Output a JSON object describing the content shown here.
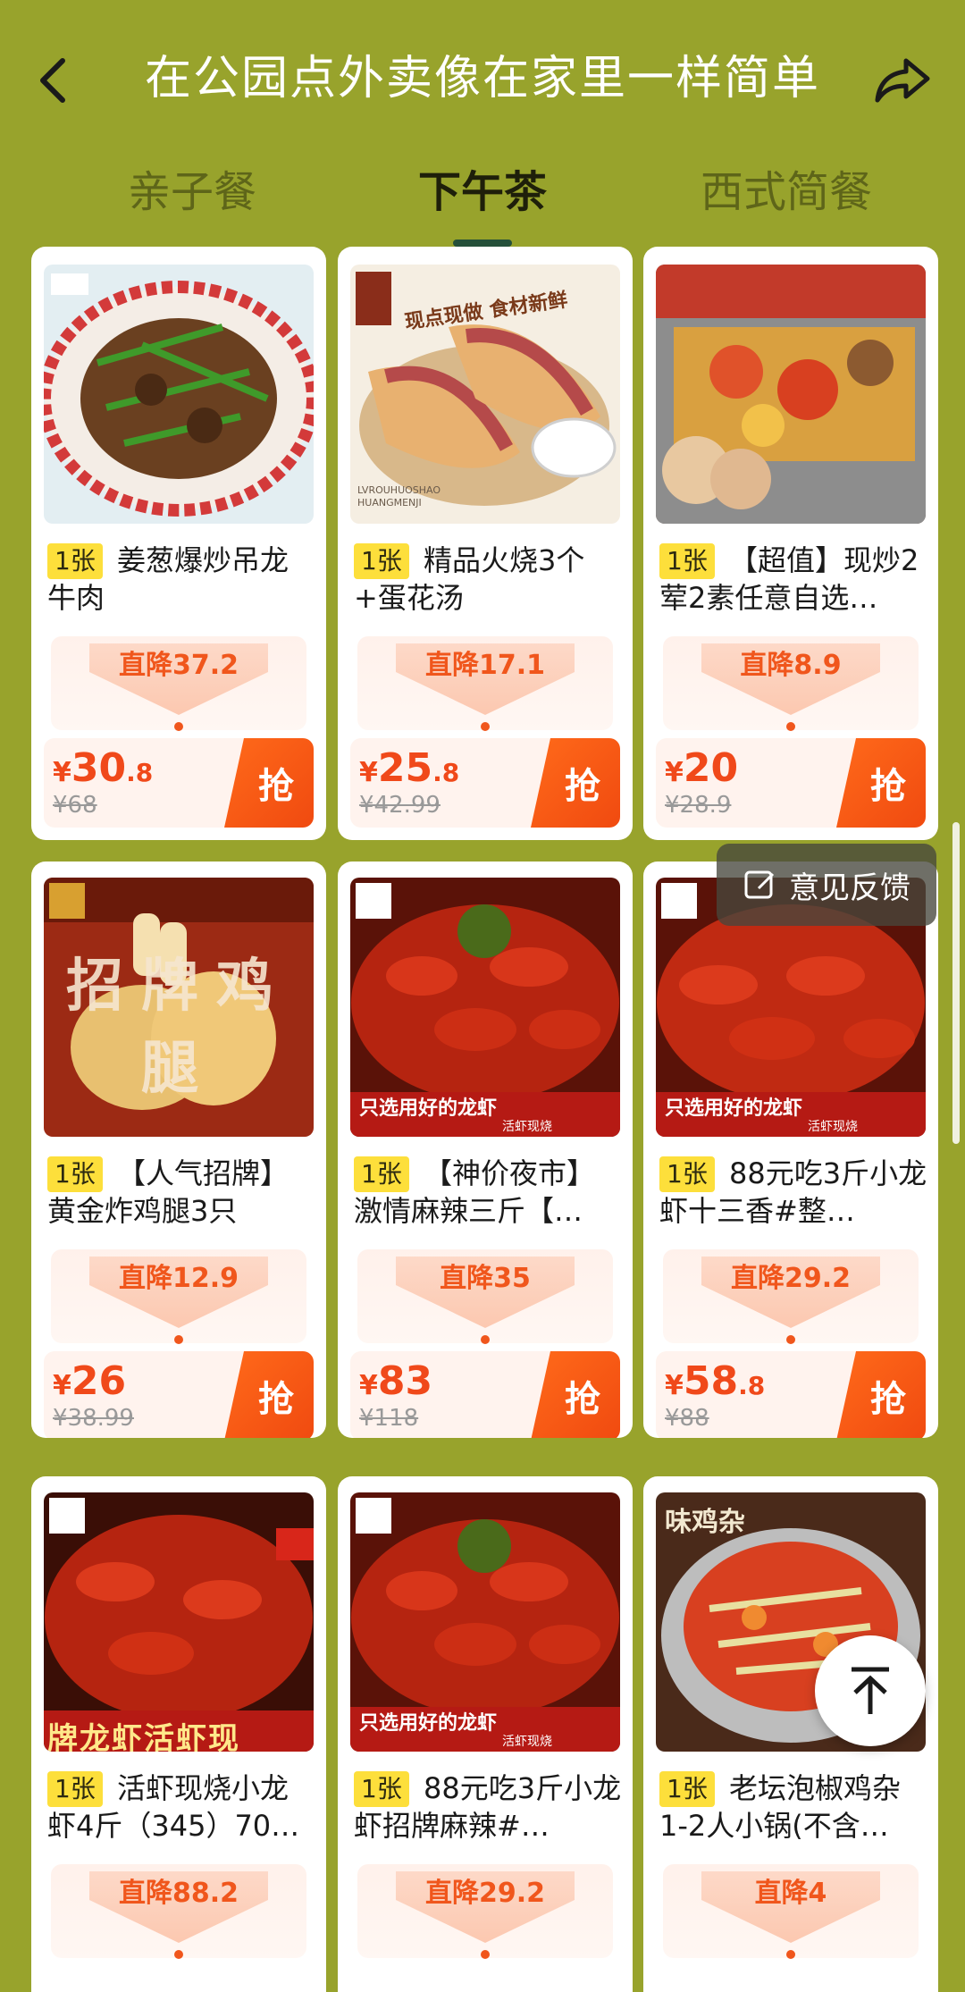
{
  "header": {
    "title": "在公园点外卖像在家里一样简单",
    "back_icon": "back-arrow-icon",
    "share_icon": "share-icon"
  },
  "tabs": [
    {
      "label": "亲子餐",
      "active": false
    },
    {
      "label": "下午茶",
      "active": true
    },
    {
      "label": "西式简餐",
      "active": false
    }
  ],
  "colors": {
    "background": "#98a32c",
    "accent": "#f0491a",
    "tag": "#fddf3b",
    "tab_underline": "#25503a"
  },
  "products": [
    {
      "tag": "1张",
      "title": "姜葱爆炒吊龙牛肉",
      "discount": "直降37.2",
      "price_main": "30",
      "price_dec": ".8",
      "yen": "¥",
      "orig_price": "¥68",
      "btn": "抢",
      "image": "beef-stirfry-image"
    },
    {
      "tag": "1张",
      "title": "精品火烧3个+蛋花汤",
      "discount": "直降17.1",
      "price_main": "25",
      "price_dec": ".8",
      "yen": "¥",
      "orig_price": "¥42.99",
      "btn": "抢",
      "image": "huoshao-sandwich-image"
    },
    {
      "tag": "1张",
      "title": "【超值】现炒2荤2素任意自选…",
      "discount": "直降8.9",
      "price_main": "20",
      "price_dec": "",
      "yen": "¥",
      "orig_price": "¥28.9",
      "btn": "抢",
      "image": "stirfry-box-image"
    },
    {
      "tag": "1张",
      "title": "【人气招牌】黄金炸鸡腿3只",
      "discount": "直降12.9",
      "price_main": "26",
      "price_dec": "",
      "yen": "¥",
      "orig_price": "¥38.99",
      "btn": "抢",
      "image": "fried-chicken-leg-image"
    },
    {
      "tag": "1张",
      "title": "【神价夜市】激情麻辣三斤【…",
      "discount": "直降35",
      "price_main": "83",
      "price_dec": "",
      "yen": "¥",
      "orig_price": "¥118",
      "btn": "抢",
      "image": "crayfish-spicy-image"
    },
    {
      "tag": "1张",
      "title": "88元吃3斤小龙虾十三香#整…",
      "discount": "直降29.2",
      "price_main": "58",
      "price_dec": ".8",
      "yen": "¥",
      "orig_price": "¥88",
      "btn": "抢",
      "image": "crayfish-thirteen-spice-image"
    },
    {
      "tag": "1张",
      "title": "活虾现烧小龙虾4斤（345）70…",
      "discount": "直降88.2",
      "price_main": "",
      "price_dec": "",
      "yen": "",
      "orig_price": "",
      "btn": "",
      "image": "crayfish-live-image"
    },
    {
      "tag": "1张",
      "title": "88元吃3斤小龙虾招牌麻辣#…",
      "discount": "直降29.2",
      "price_main": "",
      "price_dec": "",
      "yen": "",
      "orig_price": "",
      "btn": "",
      "image": "crayfish-mala-image"
    },
    {
      "tag": "1张",
      "title": "老坛泡椒鸡杂1-2人小锅(不含…",
      "discount": "直降4",
      "price_main": "",
      "price_dec": "",
      "yen": "",
      "orig_price": "",
      "btn": "",
      "image": "chicken-offal-pot-image"
    }
  ],
  "image_overlays": {
    "huoshao_banner": "现点现做 食材新鲜",
    "huoshao_brand": "LVROUHUOSHAO HUANGMENJI",
    "chicken_sign": "招牌鸡腿",
    "crayfish_banner": "只选用好的龙虾",
    "crayfish_sub": "活虾现烧",
    "crayfish_live_banner": "牌龙虾活虾现",
    "chicken_offal_sign": "味鸡杂"
  },
  "feedback": {
    "label": "意见反馈",
    "icon": "feedback-edit-icon"
  },
  "back_to_top": {
    "icon": "arrow-up-icon"
  }
}
